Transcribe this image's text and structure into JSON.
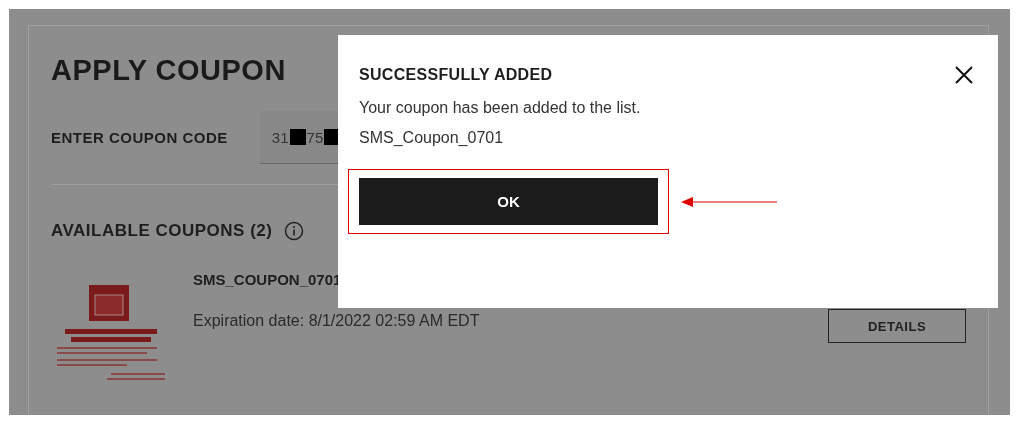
{
  "page": {
    "title": "APPLY COUPON",
    "code_label": "ENTER COUPON CODE",
    "code_parts": [
      "31",
      "75"
    ],
    "available_title": "AVAILABLE COUPONS (2)",
    "coupons": [
      {
        "name": "SMS_COUPON_0701",
        "expiration": "Expiration date: 8/1/2022 02:59 AM EDT",
        "button": "DETAILS"
      }
    ]
  },
  "dialog": {
    "title": "SUCCESSFULLY ADDED",
    "message": "Your coupon has been added to the list.",
    "coupon": "SMS_Coupon_0701",
    "ok": "OK"
  }
}
